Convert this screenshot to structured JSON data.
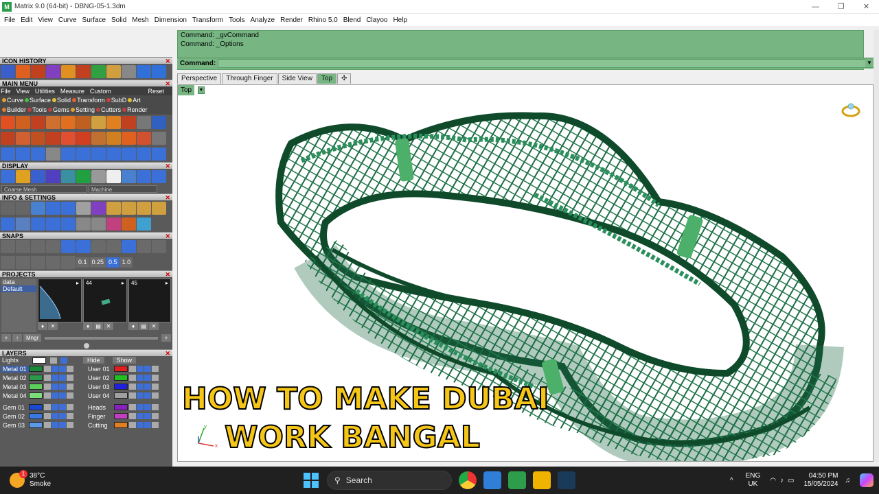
{
  "window": {
    "title": "Matrix 9.0 (64-bit) - DBNG-05-1.3dm",
    "app_icon": "M",
    "minimize": "—",
    "maximize": "❐",
    "close": "✕"
  },
  "menubar": [
    "File",
    "Edit",
    "View",
    "Curve",
    "Surface",
    "Solid",
    "Mesh",
    "Dimension",
    "Transform",
    "Tools",
    "Analyze",
    "Render",
    "Rhino 5.0",
    "Blend",
    "Clayoo",
    "Help"
  ],
  "left_panel": {
    "icon_history": "ICON HISTORY",
    "main_menu": "MAIN MENU",
    "main_submenu": [
      "File",
      "View",
      "Utilities",
      "Measure",
      "Custom"
    ],
    "reset": "Reset",
    "categories_row1": [
      {
        "label": "Curve",
        "color": "#e0a030"
      },
      {
        "label": "Surface",
        "color": "#40c040"
      },
      {
        "label": "Solid",
        "color": "#e0c030"
      },
      {
        "label": "Transform",
        "color": "#e06030"
      },
      {
        "label": "SubD",
        "color": "#d04040"
      },
      {
        "label": "Art",
        "color": "#e0c030"
      }
    ],
    "categories_row2": [
      {
        "label": "Builder",
        "color": "#e08030"
      },
      {
        "label": "Tools",
        "color": "#c04040"
      },
      {
        "label": "Gems",
        "color": "#c04040"
      },
      {
        "label": "Setting",
        "color": "#e0a030"
      },
      {
        "label": "Cutters",
        "color": "#c04040"
      },
      {
        "label": "Render",
        "color": "#c04040"
      }
    ],
    "display": "DISPLAY",
    "display_mesh": "Coarse Mesh",
    "display_render": "Machine",
    "info_settings": "INFO & SETTINGS",
    "snaps": "SNAPS",
    "snap_values": [
      "0.1",
      "0.25",
      "0.5",
      "1.0"
    ],
    "projects": "PROJECTS",
    "project_items": [
      "data",
      "Default"
    ],
    "thumb_labels": [
      "",
      "44",
      "45"
    ],
    "mngr": "Mngr",
    "layers": "LAYERS",
    "lights": "Lights",
    "hide": "Hide",
    "show": "Show",
    "layer_left": [
      {
        "name": "Metal 01",
        "color": "#1a8a3a",
        "active": true
      },
      {
        "name": "Metal 02",
        "color": "#2a9a4a",
        "active": false
      },
      {
        "name": "Metal 03",
        "color": "#5acf5a",
        "active": false
      },
      {
        "name": "Metal 04",
        "color": "#7adf7a",
        "active": false
      },
      {
        "name": "Gem 01",
        "color": "#1a4ad0",
        "active": false
      },
      {
        "name": "Gem 02",
        "color": "#3a7ae0",
        "active": false
      },
      {
        "name": "Gem 03",
        "color": "#5a9ae8",
        "active": false
      }
    ],
    "layer_right": [
      {
        "name": "User 01",
        "color": "#e02020"
      },
      {
        "name": "User 02",
        "color": "#20c020"
      },
      {
        "name": "User 03",
        "color": "#2020e0"
      },
      {
        "name": "User 04",
        "color": "#a0a0a0"
      },
      {
        "name": "Heads",
        "color": "#8a20c0"
      },
      {
        "name": "Finger",
        "color": "#c040c0"
      },
      {
        "name": "Cutting",
        "color": "#e08020"
      }
    ]
  },
  "command": {
    "history": [
      "Command: _gvCommand",
      "Command: _Options"
    ],
    "prompt": "Command:"
  },
  "viewport_tabs": [
    {
      "label": "Perspective",
      "active": false
    },
    {
      "label": "Through Finger",
      "active": false
    },
    {
      "label": "Side View",
      "active": false
    },
    {
      "label": "Top",
      "active": true
    },
    {
      "label": "✣",
      "active": false
    }
  ],
  "viewport_label": "Top",
  "overlay_text": {
    "line1": "HOW TO MAKE DUBAI",
    "line2": "WORK BANGAL"
  },
  "taskbar": {
    "temp": "38°C",
    "condition": "Smoke",
    "badge": "1",
    "search": "Search",
    "lang": "ENG",
    "region": "UK",
    "time": "04:50 PM",
    "date": "15/05/2024",
    "chevron": "^"
  },
  "colors": {
    "command_green": "#77b682",
    "model_green": "#1f6b45",
    "overlay_yellow": "#f5c518"
  }
}
